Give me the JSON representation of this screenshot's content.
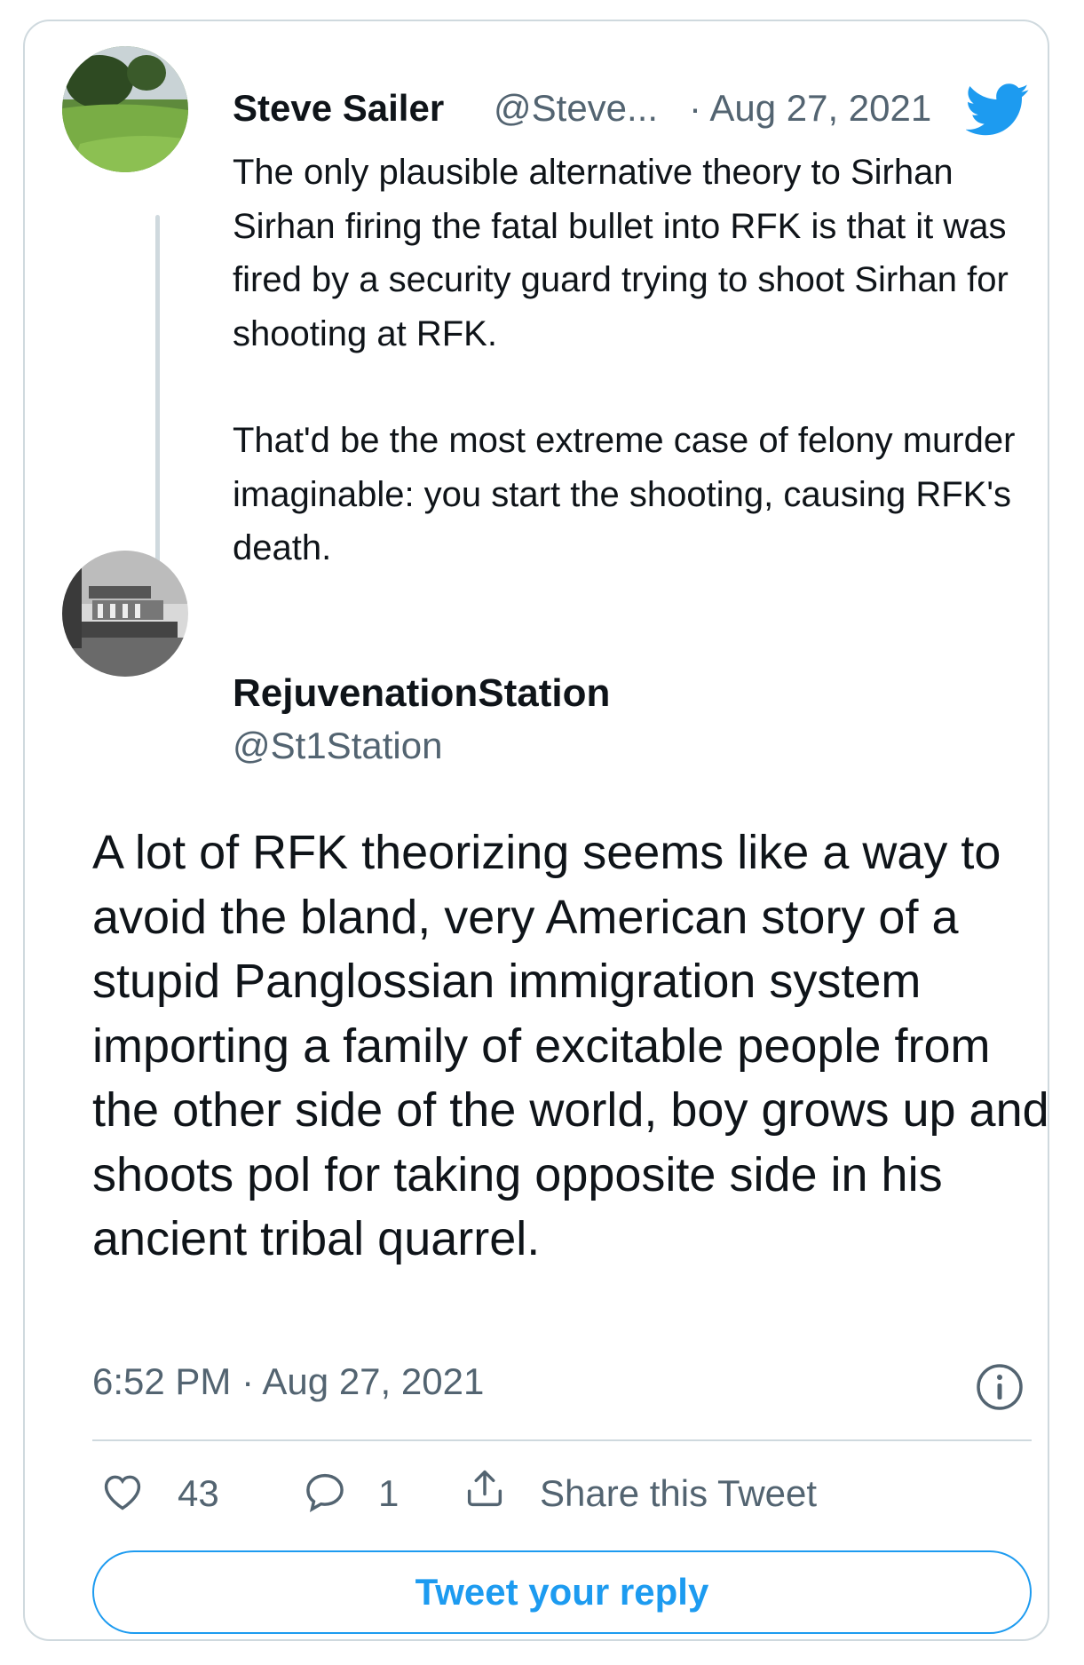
{
  "quoted_tweet": {
    "display_name": "Steve Sailer",
    "handle": "@Steve...",
    "date": "· Aug 27, 2021",
    "paragraphs": [
      "The only plausible alternative theory to Sirhan Sirhan firing the fatal bullet into RFK is that it was fired by a security guard trying to shoot Sirhan for shooting at RFK.",
      "That'd be the most extreme case of felony murder imaginable: you start the shooting, causing RFK's death."
    ]
  },
  "main_tweet": {
    "display_name": "RejuvenationStation",
    "handle": "@St1Station",
    "text": "A lot of RFK theorizing seems like a way to avoid the bland, very American story of a stupid Panglossian immigration system importing a family of excitable people from the other side of the world, boy grows up and shoots pol for taking opposite side in his ancient tribal quarrel.",
    "timestamp": "6:52 PM · Aug 27, 2021"
  },
  "actions": {
    "like_count": "43",
    "reply_count": "1",
    "share_label": "Share this Tweet"
  },
  "reply_button_label": "Tweet your reply",
  "icons": [
    "avatar-golf-course",
    "twitter-bird-icon",
    "avatar-boat",
    "info-icon",
    "heart-icon",
    "reply-bubble-icon",
    "share-icon"
  ],
  "colors": {
    "brand_blue": "#1d9bf0",
    "text_primary": "#0f1419",
    "text_secondary": "#536471",
    "border": "#cfd9de"
  }
}
